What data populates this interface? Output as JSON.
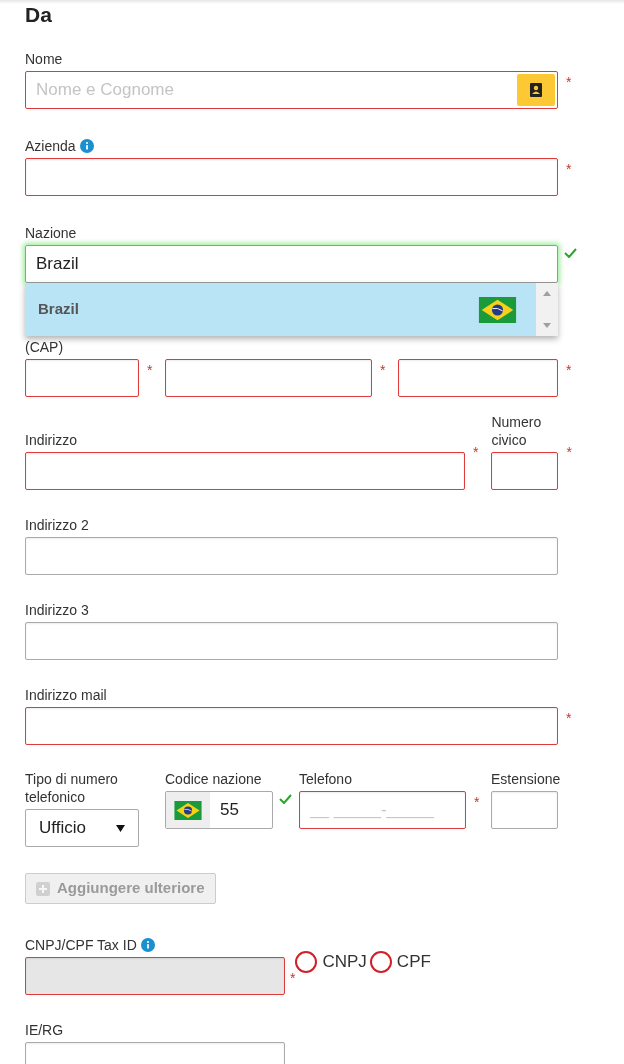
{
  "section_title": "Da",
  "required_mark": "*",
  "nome": {
    "label": "Nome",
    "placeholder": "Nome e Cognome",
    "required": true
  },
  "azienda": {
    "label": "Azienda",
    "required": true
  },
  "nazione": {
    "label": "Nazione",
    "value": "Brazil",
    "valid": true,
    "suggestions": [
      {
        "label": "Brazil",
        "selected": true
      }
    ]
  },
  "postal": {
    "label": "(CAP)",
    "fields": [
      {
        "required": true
      },
      {
        "required": true
      },
      {
        "required": true
      }
    ]
  },
  "indirizzo": {
    "label": "Indirizzo",
    "required": true
  },
  "numero_civico": {
    "label": "Numero civico",
    "required": true
  },
  "indirizzo_2": {
    "label": "Indirizzo 2",
    "required": false
  },
  "indirizzo_3": {
    "label": "Indirizzo 3",
    "required": false
  },
  "indirizzo_mail": {
    "label": "Indirizzo mail",
    "required": true
  },
  "phone": {
    "type": {
      "label": "Tipo di numero telefonico",
      "value": "Ufficio"
    },
    "country_code": {
      "label": "Codice nazione",
      "value": "55",
      "valid": true
    },
    "telefono": {
      "label": "Telefono",
      "placeholder": "__ _____-_____",
      "required": true
    },
    "estensione": {
      "label": "Estensione",
      "required": false
    }
  },
  "add_button": {
    "label": "Aggiungere ulteriore",
    "disabled": true
  },
  "tax_id": {
    "label": "CNPJ/CPF Tax ID",
    "required": true,
    "disabled": true,
    "options": [
      {
        "label": "CNPJ",
        "selected": false
      },
      {
        "label": "CPF",
        "selected": false
      }
    ]
  },
  "ie_rg": {
    "label": "IE/RG",
    "required": false
  }
}
